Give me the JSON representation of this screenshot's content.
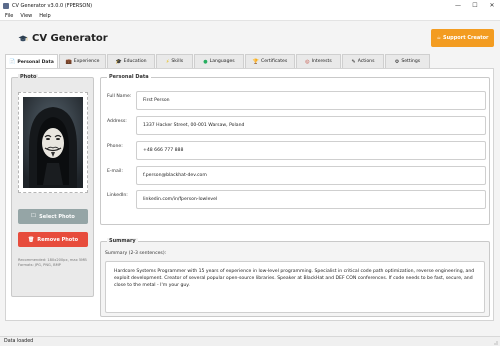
{
  "window": {
    "title": "CV Generator v3.0.0 (FPERSON)",
    "controls": {
      "minimize": "—",
      "maximize": "☐",
      "close": "✕"
    }
  },
  "menu": [
    "File",
    "View",
    "Help"
  ],
  "header": {
    "title": "CV Generator",
    "icon": "graduation-cap-icon",
    "support_button": "Support Creator",
    "support_color": "#f39c21"
  },
  "tabs": [
    {
      "label": "Personal Data",
      "icon": "📄",
      "active": true
    },
    {
      "label": "Experience",
      "icon": "💼"
    },
    {
      "label": "Education",
      "icon": "🎓"
    },
    {
      "label": "Skills",
      "icon": "⚡"
    },
    {
      "label": "Languages",
      "icon": "●"
    },
    {
      "label": "Certificates",
      "icon": "🏆"
    },
    {
      "label": "Interests",
      "icon": "◎"
    },
    {
      "label": "Actions",
      "icon": "✎"
    },
    {
      "label": "Settings",
      "icon": "⚙"
    }
  ],
  "photo_section": {
    "legend": "Photo",
    "select_button": "Select Photo",
    "select_icon": "🗀",
    "remove_button": "Remove Photo",
    "remove_icon": "🗑",
    "note": "Recommended: 180x200px, max 5MB Formats: JPG, PNG, BMP",
    "select_color": "#95a5a6",
    "remove_color": "#e74c3c"
  },
  "personal_section": {
    "legend": "Personal Data",
    "fields": [
      {
        "label": "Full Name:",
        "value": "First Person"
      },
      {
        "label": "Address:",
        "value": "1337 Hacker Street, 00-001 Warsaw, Poland"
      },
      {
        "label": "Phone:",
        "value": "+48 666 777 888"
      },
      {
        "label": "E-mail:",
        "value": "f.person@blackhat-dev.com"
      },
      {
        "label": "LinkedIn:",
        "value": "linkedin.com/in/fperson-lowlevel"
      }
    ]
  },
  "summary_section": {
    "legend": "Summary",
    "label": "Summary (2-3 sentences):",
    "text": "Hardcore Systems Programmer with 15 years of experience in low-level programming. Specialist in critical code path optimization, reverse engineering, and exploit development. Creator of several popular open-source libraries. Speaker at BlackHat and DEF CON conferences. If code needs to be fast, secure, and close to the metal - I'm your guy."
  },
  "status": "Data loaded"
}
